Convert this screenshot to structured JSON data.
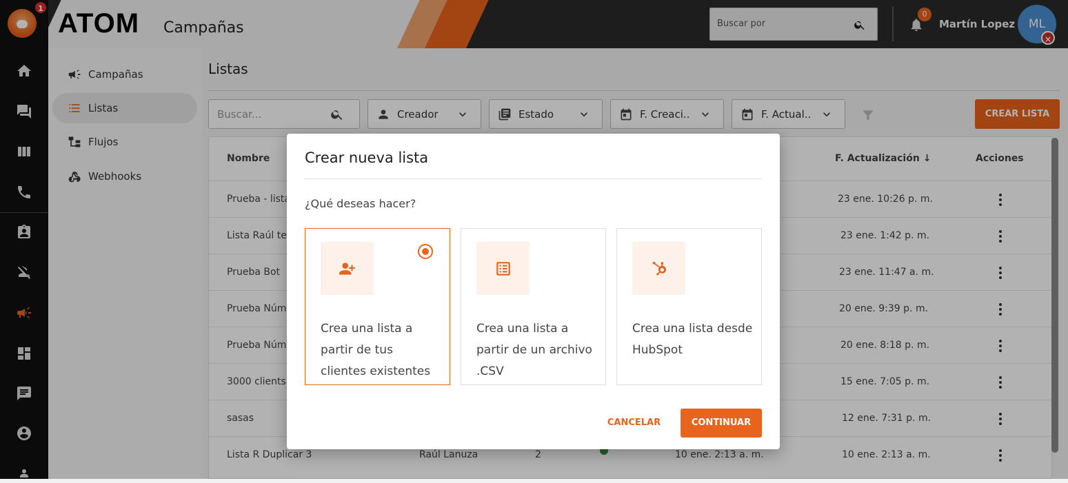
{
  "app": {
    "brand": "ATOM",
    "section": "Campañas",
    "notification_badge": "1",
    "accent_color": "#e8641c"
  },
  "header": {
    "search_placeholder": "Buscar por",
    "notifications_count": "0",
    "user_name": "Martín Lopez",
    "user_initials": "ML"
  },
  "rail": {
    "icons": [
      "home-icon",
      "chat-icon",
      "columns-icon",
      "phone-icon",
      "contact-card-icon",
      "user-off-icon",
      "megaphone-icon",
      "dashboard-icon",
      "message-icon",
      "account-icon",
      "group-icon"
    ]
  },
  "submenu": {
    "items": [
      {
        "label": "Campañas",
        "icon": "megaphone-icon"
      },
      {
        "label": "Listas",
        "icon": "list-icon",
        "active": true
      },
      {
        "label": "Flujos",
        "icon": "flow-icon"
      },
      {
        "label": "Webhooks",
        "icon": "webhook-icon"
      }
    ]
  },
  "main": {
    "title": "Listas",
    "search_placeholder": "Buscar...",
    "filters": {
      "creator": "Creador",
      "status": "Estado",
      "created": "F. Creaci..",
      "updated": "F. Actual.."
    },
    "create_button": "CREAR LISTA"
  },
  "table": {
    "headers": {
      "name": "Nombre",
      "updated": "F. Actualización",
      "actions": "Acciones"
    },
    "rows": [
      {
        "name": "Prueba - lista",
        "updated": "23 ene. 10:26 p. m."
      },
      {
        "name": "Lista Raúl test",
        "updated": "23 ene. 1:42 p. m."
      },
      {
        "name": "Prueba Bot",
        "updated": "23 ene. 11:47 a. m."
      },
      {
        "name": "Prueba Números",
        "updated": "20 ene. 9:39 p. m."
      },
      {
        "name": "Prueba Números",
        "updated": "20 ene. 8:18 p. m."
      },
      {
        "name": "3000 clients",
        "updated": "15 ene. 7:05 p. m."
      },
      {
        "name": "sasas",
        "updated": "12 ene. 7:31 p. m."
      },
      {
        "name": "Lista R Duplicar 3",
        "creator": "Raúl Lanuza",
        "count": "2",
        "created": "10 ene. 2:13 a. m.",
        "updated": "10 ene. 2:13 a. m."
      }
    ]
  },
  "modal": {
    "title": "Crear nueva lista",
    "question": "¿Qué deseas hacer?",
    "options": [
      {
        "text": "Crea una lista a partir de tus clientes existentes",
        "icon": "person-add-icon",
        "selected": true
      },
      {
        "text": "Crea una lista a partir de un archivo .CSV",
        "icon": "list-document-icon"
      },
      {
        "text": "Crea una lista desde HubSpot",
        "icon": "hubspot-icon"
      }
    ],
    "cancel": "CANCELAR",
    "continue": "CONTINUAR"
  }
}
